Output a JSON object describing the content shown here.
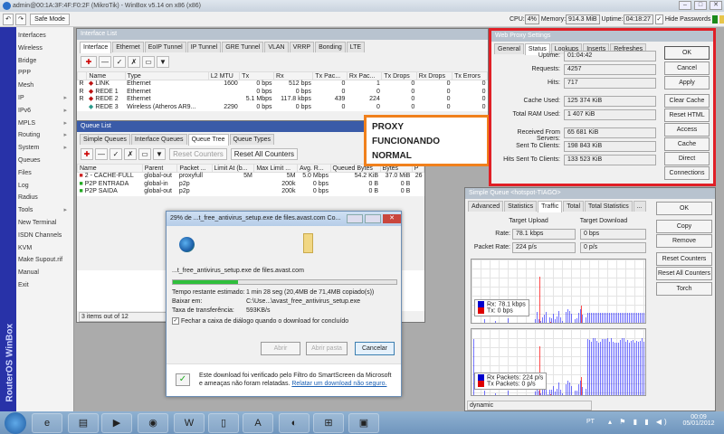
{
  "window": {
    "title": "admin@00:1A:3F:4F:F0:2F (MikroTik) - WinBox v5.14 on x86 (x86)",
    "min": "–",
    "max": "□",
    "close": "✕"
  },
  "toolbar": {
    "undo": "↶",
    "redo": "↷",
    "safe_mode": "Safe Mode",
    "cpu_label": "CPU:",
    "cpu": "4%",
    "memory_label": "Memory:",
    "memory": "914.3 MiB",
    "uptime_label": "Uptime:",
    "uptime": "04:18:27",
    "hide_passwords": "Hide Passwords"
  },
  "sidebar": {
    "brand": "RouterOS WinBox",
    "items": [
      {
        "label": "Interfaces"
      },
      {
        "label": "Wireless"
      },
      {
        "label": "Bridge"
      },
      {
        "label": "PPP"
      },
      {
        "label": "Mesh"
      },
      {
        "label": "IP",
        "arrow": "▸"
      },
      {
        "label": "IPv6",
        "arrow": "▸"
      },
      {
        "label": "MPLS",
        "arrow": "▸"
      },
      {
        "label": "Routing",
        "arrow": "▸"
      },
      {
        "label": "System",
        "arrow": "▸"
      },
      {
        "label": "Queues"
      },
      {
        "label": "Files"
      },
      {
        "label": "Log"
      },
      {
        "label": "Radius"
      },
      {
        "label": "Tools",
        "arrow": "▸"
      },
      {
        "label": "New Terminal"
      },
      {
        "label": "ISDN Channels"
      },
      {
        "label": "KVM"
      },
      {
        "label": "Make Supout.rif"
      },
      {
        "label": "Manual"
      },
      {
        "label": "Exit"
      }
    ]
  },
  "interface_list": {
    "title": "Interface List",
    "tabs": [
      "Interface",
      "Ethernet",
      "EoIP Tunnel",
      "IP Tunnel",
      "GRE Tunnel",
      "VLAN",
      "VRRP",
      "Bonding",
      "LTE"
    ],
    "columns": [
      "",
      "Name",
      "Type",
      "L2 MTU",
      "Tx",
      "Rx",
      "Tx Pac...",
      "Rx Pac...",
      "Tx Drops",
      "Rx Drops",
      "Tx Errors"
    ],
    "rows": [
      [
        "R",
        "LINK",
        "Ethernet",
        "1600",
        "0 bps",
        "512 bps",
        "0",
        "1",
        "0",
        "0",
        "0"
      ],
      [
        "R",
        "REDE 1",
        "Ethernet",
        "",
        "0 bps",
        "0 bps",
        "0",
        "0",
        "0",
        "0",
        "0"
      ],
      [
        "R",
        "REDE 2",
        "Ethernet",
        "",
        "5.1 Mbps",
        "117.8 kbps",
        "439",
        "224",
        "0",
        "0",
        "0"
      ],
      [
        "",
        "REDE 3",
        "Wireless (Atheros AR9...",
        "2290",
        "0 bps",
        "0 bps",
        "0",
        "0",
        "0",
        "0",
        "0"
      ]
    ]
  },
  "queue_list": {
    "title": "Queue List",
    "tabs": [
      "Simple Queues",
      "Interface Queues",
      "Queue Tree",
      "Queue Types"
    ],
    "reset_counters": "Reset Counters",
    "reset_all_counters": "Reset All Counters",
    "columns": [
      "Name",
      "Parent",
      "Packet ...",
      "Limit At (b...",
      "Max Limit ...",
      "Avg. R...",
      "Queued Bytes",
      "Bytes",
      "P"
    ],
    "rows": [
      [
        "2 - CACHE-FULL",
        "global-out",
        "proxyfull",
        "5M",
        "5M",
        "5.0 Mbps",
        "54.2 KiB",
        "37.0 MiB",
        "26"
      ],
      [
        "P2P ENTRADA",
        "global-in",
        "p2p",
        "",
        "200k",
        "0 bps",
        "0 B",
        "0 B",
        ""
      ],
      [
        "P2P SAIDA",
        "global-out",
        "p2p",
        "",
        "200k",
        "0 bps",
        "0 B",
        "0 B",
        ""
      ]
    ],
    "status": "3 items out of 12"
  },
  "annotation": {
    "line1": "PROXY",
    "line2": "FUNCIONANDO",
    "line3": "NORMAL"
  },
  "web_proxy": {
    "title": "Web Proxy Settings",
    "tabs": [
      "General",
      "Status",
      "Lookups",
      "Inserts",
      "Refreshes"
    ],
    "fields": [
      {
        "label": "Uptime:",
        "value": "01:04:42"
      },
      {
        "label": "Requests:",
        "value": "4257"
      },
      {
        "label": "Hits:",
        "value": "717"
      },
      {
        "label": "Cache Used:",
        "value": "125 374 KiB"
      },
      {
        "label": "Total RAM Used:",
        "value": "1 407 KiB"
      },
      {
        "label": "Received From Servers:",
        "value": "65 681 KiB"
      },
      {
        "label": "Sent To Clients:",
        "value": "198 843 KiB"
      },
      {
        "label": "Hits Sent To Clients:",
        "value": "133 523 KiB"
      }
    ],
    "buttons": [
      "OK",
      "Cancel",
      "Apply",
      "Clear Cache",
      "Reset HTML",
      "Access",
      "Cache",
      "Direct",
      "Connections"
    ]
  },
  "simple_queue": {
    "title": "Simple Queue <hotspot-TIAGO>",
    "tabs": [
      "Advanced",
      "Statistics",
      "Traffic",
      "Total",
      "Total Statistics",
      "..."
    ],
    "target_upload": "Target Upload",
    "target_download": "Target Download",
    "rate_label": "Rate:",
    "rate_up": "78.1 kbps",
    "rate_down": "0 bps",
    "packet_rate_label": "Packet Rate:",
    "packet_up": "224 p/s",
    "packet_down": "0 p/s",
    "legend1": {
      "rx": "Rx:  78.1 kbps",
      "tx": "Tx:  0 bps"
    },
    "legend2": {
      "rx": "Rx Packets:  224 p/s",
      "tx": "Tx Packets:  0 p/s"
    },
    "buttons": [
      "OK",
      "Copy",
      "Remove",
      "Reset Counters",
      "Reset All Counters",
      "Torch"
    ],
    "status": "dynamic",
    "colors": {
      "rx": "#0000ff",
      "tx": "#ff0000"
    }
  },
  "download": {
    "title": "29% de ...t_free_antivirus_setup.exe de files.avast.com Co...",
    "file": "...t_free_antivirus_setup.exe de files.avast.com",
    "progress": 0.29,
    "time_label": "Tempo restante estimado:",
    "time": "1 min 28 seg (20,4MB de 71,4MB copiado(s))",
    "dest_label": "Baixar em:",
    "dest": "C:\\Use...\\avast_free_antivirus_setup.exe",
    "rate_label": "Taxa de transferência:",
    "rate": "593KB/s",
    "close_when_done": "Fechar a caixa de diálogo quando o download for concluído",
    "open": "Abrir",
    "open_folder": "Abrir pasta",
    "cancel": "Cancelar",
    "smartscreen": "Este download foi verificado pelo Filtro do SmartScreen da Microsoft e ameaças não foram relatadas.",
    "report_link": "Relatar um download não seguro."
  },
  "taskbar": {
    "lang": "PT",
    "time": "00:09",
    "date": "05/01/2012"
  }
}
